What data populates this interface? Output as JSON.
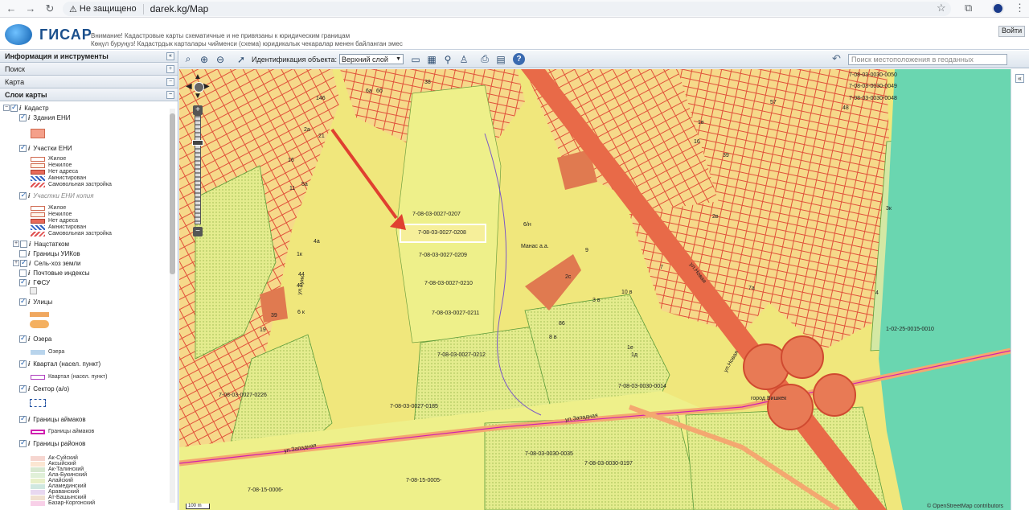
{
  "browser": {
    "security_label": "Не защищено",
    "url": "darek.kg/Map"
  },
  "header": {
    "logo_text": "ГИСАР",
    "warning_ru": "Внимание! Кадастровые карты схематичные и не привязаны к юридическим границам",
    "warning_kg": "Көңүл буруңуз! Кадастрдык карталары чийменси (схема) юридикалык чекаралар менен байланган эмес",
    "login_label": "Войти"
  },
  "sidebar": {
    "panel_title": "Информация и инструменты",
    "search_label": "Поиск",
    "map_label": "Карта",
    "layers_label": "Слои карты",
    "layers": [
      {
        "label": "Кадастр"
      },
      {
        "label": "Здания ЕНИ"
      },
      {
        "label": "Участки ЕНИ"
      },
      {
        "label": "Участки ЕНИ копия"
      },
      {
        "label": "Нацстатком"
      },
      {
        "label": "Границы УИКов"
      },
      {
        "label": "Сель-хоз земли"
      },
      {
        "label": "Почтовые индексы"
      },
      {
        "label": "ГФСУ"
      },
      {
        "label": "Улицы"
      },
      {
        "label": "Озера"
      },
      {
        "label": "Квартал (насел. пункт)"
      },
      {
        "label": "Сектор (а/о)"
      },
      {
        "label": "Границы аймаков"
      },
      {
        "label": "Границы районов"
      }
    ],
    "legend_parcels": [
      "Жилое",
      "Нежилое",
      "Нет адреса",
      "Амнистирован",
      "Самовольная застройка"
    ],
    "legend_lakes": "Озера",
    "legend_quarter": "Квартал (насел. пункт)",
    "legend_aimak": "Границы аймаков",
    "districts": [
      "Ак-Суйский",
      "Аксыйский",
      "Ак-Талинский",
      "Ала-Букинский",
      "Алайский",
      "Аламединский",
      "Араванский",
      "Ат-Башынский",
      "Базар-Коргонский"
    ]
  },
  "toolbar": {
    "identify_label": "Идентификация объекта:",
    "identify_value": "Верхний слой",
    "search_placeholder": "Поиск местоположения в геоданных"
  },
  "map": {
    "parcels": [
      {
        "id": "7-08-03-0027-0207"
      },
      {
        "id": "7-08-03-0027-0208"
      },
      {
        "id": "7-08-03-0027-0209"
      },
      {
        "id": "7-08-03-0027-0210"
      },
      {
        "id": "7-08-03-0027-0211"
      },
      {
        "id": "7-08-03-0027-0212"
      },
      {
        "id": "7-08-03-0027-0226"
      },
      {
        "id": "7-08-03-0027-0185"
      },
      {
        "id": "7-08-03-0030-0014"
      },
      {
        "id": "7-08-03-0030-0035"
      },
      {
        "id": "7-08-03-0030-0197"
      },
      {
        "id": "7-08-15-0006-"
      },
      {
        "id": "7-08-15-0005-"
      },
      {
        "id": "1-02-25-0015-0010"
      },
      {
        "id": "7-08-03-0030-0050"
      },
      {
        "id": "7-08-03-0030-0049"
      },
      {
        "id": "7-08-03-0030-0048"
      }
    ],
    "places": [
      "Манас а.а.",
      "город Бишкек"
    ],
    "streets": [
      "ул.Западная",
      "ул.Западная",
      "ул.Новая",
      "ул.Новая",
      "ул.Туик"
    ],
    "numbers": [
      "146",
      "38",
      "6а",
      "6б",
      "2а",
      "16",
      "21",
      "11",
      "5а",
      "4а",
      "1к",
      "44",
      "43",
      "39",
      "6 к",
      "19",
      "9",
      "10 в",
      "3 в",
      "2с",
      "8 в",
      "86",
      "1е",
      "1д",
      "57",
      "48",
      "39",
      "2в",
      "1в",
      "16",
      "6/н",
      "3к",
      "7",
      "7а",
      "4"
    ],
    "scale_label": "100 m",
    "attribution": "© OpenStreetMap contributors"
  }
}
